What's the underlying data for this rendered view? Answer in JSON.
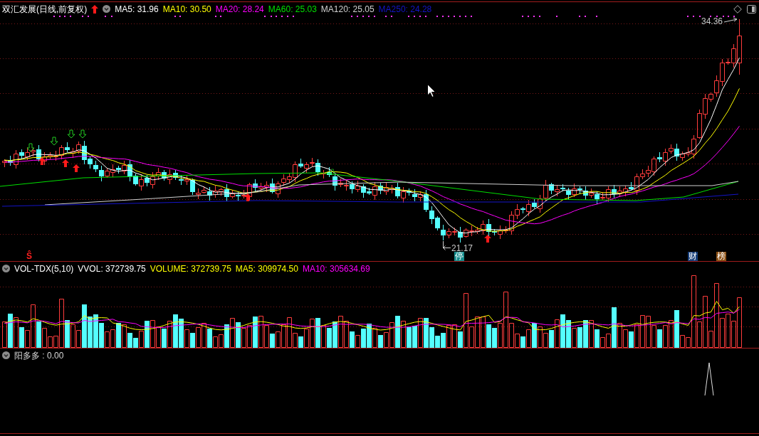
{
  "main_chart": {
    "title": "双汇发展(日线,前复权)",
    "legend": [
      {
        "text": "MA5: 31.96",
        "color": "#ffffff"
      },
      {
        "text": "MA10: 30.50",
        "color": "#ffff00"
      },
      {
        "text": "MA20: 28.24",
        "color": "#ff00ff"
      },
      {
        "text": "MA60: 25.03",
        "color": "#00e000"
      },
      {
        "text": "MA120: 25.05",
        "color": "#d0d0d0"
      },
      {
        "text": "MA250: 24.28",
        "color": "#1414c8"
      }
    ],
    "high_label": "34.36",
    "low_label": "21.17",
    "markers": [
      {
        "kind": "symbol",
        "text": "Ŝ",
        "color": "#ff2020"
      },
      {
        "kind": "badge",
        "text": "停",
        "color": "#148c8c"
      },
      {
        "kind": "badge",
        "text": "财",
        "color": "#143c78"
      },
      {
        "kind": "badge",
        "text": "榜",
        "color": "#8c5014"
      }
    ]
  },
  "volume_chart": {
    "title": "VOL-TDX(5,10)",
    "legend": [
      {
        "text": "VVOL: 372739.75",
        "color": "#ffffff"
      },
      {
        "text": "VOLUME: 372739.75",
        "color": "#ffff00"
      },
      {
        "text": "MA5: 309974.50",
        "color": "#ffff00"
      },
      {
        "text": "MA10: 305634.69",
        "color": "#ff00ff"
      }
    ]
  },
  "indicator_chart": {
    "title": "阳多多 : 0.00"
  }
}
